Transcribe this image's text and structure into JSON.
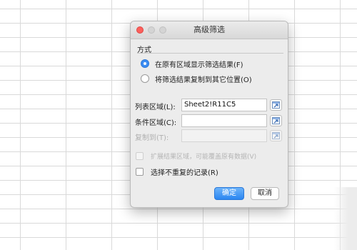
{
  "dialog": {
    "title": "高级筛选",
    "section_title": "方式",
    "options": [
      {
        "label": "在原有区域显示筛选结果(F)",
        "selected": true
      },
      {
        "label": "将筛选结果复制到其它位置(O)",
        "selected": false
      }
    ],
    "fields": {
      "list_range": {
        "label": "列表区域(L):",
        "value": "Sheet2!R11C5"
      },
      "criteria_range": {
        "label": "条件区域(C):",
        "value": ""
      },
      "copy_to": {
        "label": "复制到(T):",
        "value": "",
        "enabled": false
      }
    },
    "checkboxes": {
      "extend": {
        "label": "扩展结果区域，可能覆盖原有数据(V)",
        "checked": false,
        "enabled": false
      },
      "unique": {
        "label": "选择不重复的记录(R)",
        "checked": false,
        "enabled": true
      }
    },
    "buttons": {
      "ok": "确定",
      "cancel": "取消"
    }
  },
  "colors": {
    "accent": "#2b86f1",
    "close": "#fc605c",
    "dialog_bg": "#ececec"
  },
  "icons": [
    "close-window-icon",
    "minimize-window-icon",
    "maximize-window-icon",
    "collapse-dialog-icon"
  ]
}
